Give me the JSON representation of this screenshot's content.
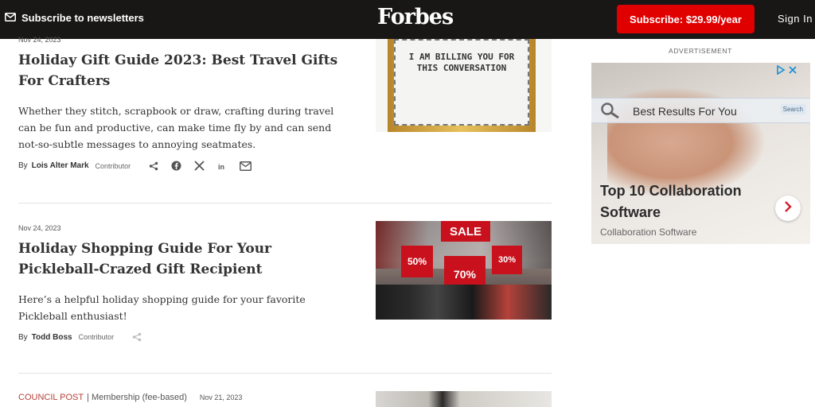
{
  "header": {
    "newsletter_label": "Subscribe to newsletters",
    "logo": "Forbes",
    "subscribe_label": "Subscribe: $29.99/year",
    "signin_label": "Sign In"
  },
  "articles": [
    {
      "date": "Nov 24, 2023",
      "headline": "Holiday Gift Guide 2023: Best Travel Gifts For Crafters",
      "summary": "Whether they stitch, scrapbook or draw, crafting during travel can be fun and productive, can make time fly by and can send not-so-subtle messages to annoying seatmates.",
      "by": "By",
      "author": "Lois Alter Mark",
      "role": "Contributor",
      "image_text": "I AM BILLING YOU FOR THIS CONVERSATION"
    },
    {
      "date": "Nov 24, 2023",
      "headline": "Holiday Shopping Guide For Your Pickleball-Crazed Gift Recipient",
      "summary": "Here’s a helpful holiday shopping guide for your favorite Pickleball enthusiast!",
      "by": "By",
      "author": "Todd Boss",
      "role": "Contributor",
      "image_signs": [
        "SALE",
        "50%",
        "70%",
        "30%"
      ]
    },
    {
      "tag": "COUNCIL POST",
      "membership": "| Membership (fee-based)",
      "date": "Nov 21, 2023"
    }
  ],
  "ad": {
    "label": "ADVERTISEMENT",
    "search_text": "Best Results For You",
    "search_button": "Search",
    "title": "Top 10 Collaboration Software",
    "subtitle": "Collaboration Software"
  },
  "colors": {
    "topbar": "#181716",
    "subscribe": "#e00000",
    "council": "#b5413a"
  }
}
